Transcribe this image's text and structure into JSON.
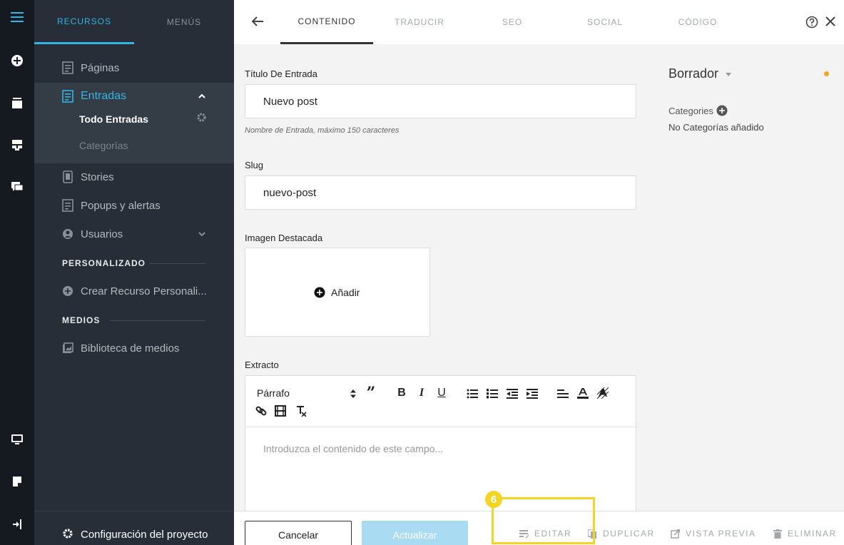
{
  "sidebar": {
    "tabs": [
      {
        "label": "RECURSOS"
      },
      {
        "label": "MENÚS"
      }
    ],
    "items": [
      {
        "label": "Páginas"
      },
      {
        "label": "Entradas"
      },
      {
        "label": "Stories"
      },
      {
        "label": "Popups y alertas"
      },
      {
        "label": "Usuarios"
      },
      {
        "label": "Crear Recurso Personali..."
      },
      {
        "label": "Biblioteca de medios"
      }
    ],
    "subitems": [
      {
        "label": "Todo Entradas"
      },
      {
        "label": "Categorías"
      }
    ],
    "sections": [
      {
        "label": "PERSONALIZADO"
      },
      {
        "label": "MEDIOS"
      }
    ],
    "footer": {
      "label": "Configuración del proyecto"
    }
  },
  "topbar": {
    "tabs": [
      {
        "label": "CONTENIDO"
      },
      {
        "label": "TRADUCIR"
      },
      {
        "label": "SEO"
      },
      {
        "label": "SOCIAL"
      },
      {
        "label": "CÓDIGO"
      }
    ]
  },
  "form": {
    "title_label": "Título De Entrada",
    "title_value": "Nuevo post",
    "title_help": "Nombre de Entrada, máximo 150 caracteres",
    "slug_label": "Slug",
    "slug_value": "nuevo-post",
    "image_label": "Imagen Destacada",
    "image_add": "Añadir",
    "excerpt_label": "Extracto",
    "paragraph_select": "Párrafo",
    "excerpt_placeholder": "Introduzca el contenido de este campo..."
  },
  "panel": {
    "status": "Borrador",
    "categories_label": "Categories",
    "categories_empty": "No Categorías añadido"
  },
  "bottom": {
    "cancel": "Cancelar",
    "update": "Actualizar",
    "actions": [
      {
        "label": "EDITAR"
      },
      {
        "label": "DUPLICAR"
      },
      {
        "label": "VISTA PREVIA"
      },
      {
        "label": "ELIMINAR"
      }
    ]
  },
  "annotation": {
    "badge": "6"
  },
  "colors": {
    "accent": "#33b5e5",
    "highlight": "#f5d523",
    "status": "#f0a81e"
  }
}
